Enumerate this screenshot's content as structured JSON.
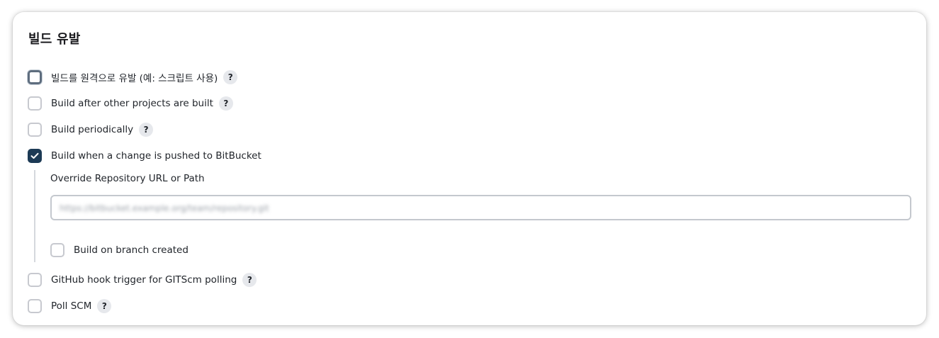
{
  "section": {
    "title": "빌드 유발"
  },
  "triggers": [
    {
      "label": "빌드를 원격으로 유발 (예: 스크립트 사용)",
      "checked": false,
      "help": "?"
    },
    {
      "label": "Build after other projects are built",
      "checked": false,
      "help": "?"
    },
    {
      "label": "Build periodically",
      "checked": false,
      "help": "?"
    },
    {
      "label": "Build when a change is pushed to BitBucket",
      "checked": true
    },
    {
      "label": "GitHub hook trigger for GITScm polling",
      "checked": false,
      "help": "?"
    },
    {
      "label": "Poll SCM",
      "checked": false,
      "help": "?"
    }
  ],
  "bitbucket": {
    "override_label": "Override Repository URL or Path",
    "override_value": "https://bitbucket.example.org/team/repository.git",
    "branch_created_label": "Build on branch created",
    "branch_created_checked": false
  },
  "colors": {
    "checked": "#1c3a55",
    "checkbox_border": "#c7c9cf",
    "help_bg": "#e6e8ec",
    "nested_line": "#d5d8dd"
  }
}
